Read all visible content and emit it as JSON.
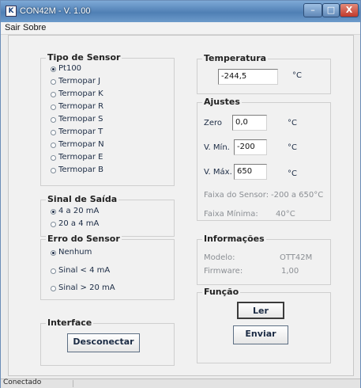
{
  "window": {
    "title": "CON42M - V. 1.00",
    "icon": "app-logo-icon",
    "icon_glyph": "K",
    "minimize_glyph": "–",
    "maximize_glyph": "□",
    "close_glyph": "X"
  },
  "menu": {
    "items": [
      "Sair",
      "Sobre"
    ]
  },
  "sensor_type": {
    "label": "Tipo de Sensor",
    "options": [
      "Pt100",
      "Termopar J",
      "Termopar K",
      "Termopar R",
      "Termopar S",
      "Termopar T",
      "Termopar N",
      "Termopar E",
      "Termopar B"
    ],
    "selected": "Pt100"
  },
  "output_signal": {
    "label": "Sinal de Saída",
    "options": [
      "4 a 20 mA",
      "20 a  4 mA"
    ],
    "selected": "4 a 20 mA"
  },
  "sensor_error": {
    "label": "Erro do Sensor",
    "options": [
      "Nenhum",
      "Sinal < 4 mA",
      "Sinal > 20 mA"
    ],
    "selected": "Nenhum"
  },
  "interface": {
    "label": "Interface",
    "disconnect_button": "Desconectar"
  },
  "temperature": {
    "label": "Temperatura",
    "value": "-244,5",
    "unit": "°C"
  },
  "adjustments": {
    "label": "Ajustes",
    "zero_label": "Zero",
    "zero_value": "0,0",
    "zero_unit": "°C",
    "min_label": "V. Mín.",
    "min_value": "-200",
    "min_unit": "°C",
    "max_label": "V. Máx.",
    "max_value": "650",
    "max_unit": "°C",
    "sensor_range_label": "Faixa do Sensor:",
    "sensor_range_value": "-200 a 650°C",
    "min_range_label": "Faixa Mínima:",
    "min_range_value": "40°C"
  },
  "info": {
    "label": "Informações",
    "model_label": "Modelo:",
    "model_value": "OTT42M",
    "firmware_label": "Firmware:",
    "firmware_value": "1,00"
  },
  "function": {
    "label": "Função",
    "read_button": "Ler",
    "send_button": "Enviar"
  },
  "status": {
    "text": "Conectado"
  }
}
